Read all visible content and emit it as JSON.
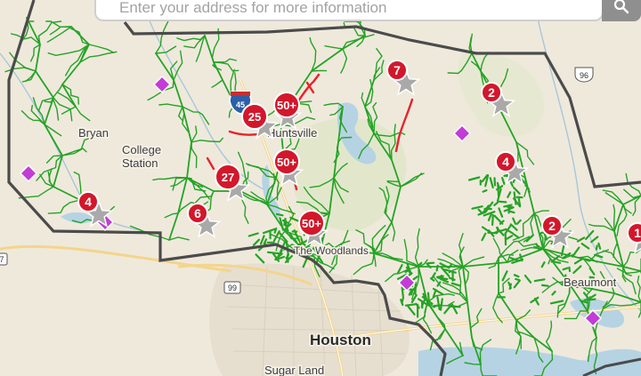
{
  "search": {
    "placeholder": "Enter your address for more information",
    "button_icon": "search-icon"
  },
  "colors": {
    "land": "#efe9dc",
    "service_lines": "#25a325",
    "outage_lines": "#e8232b",
    "boundary": "#4a4a4a",
    "marker_badge": "#d3172b",
    "marker_star": "#a8a8a8",
    "office_marker": "#c23cd6",
    "water": "#b6d3e3",
    "forest": "#dde5c6"
  },
  "cities": [
    {
      "label": "Bryan"
    },
    {
      "label": "College"
    },
    {
      "label": "Station"
    },
    {
      "label": "Huntsville"
    },
    {
      "label": "The Woodlands"
    },
    {
      "label": "Houston"
    },
    {
      "label": "Sugar Land"
    },
    {
      "label": "Beaumont"
    }
  ],
  "highway_shields": [
    {
      "label": "45",
      "type": "interstate"
    },
    {
      "label": "96",
      "type": "us"
    },
    {
      "label": "99",
      "type": "state"
    },
    {
      "label": "7",
      "type": "state"
    }
  ],
  "outage_markers": [
    {
      "count": "7"
    },
    {
      "count": "50+"
    },
    {
      "count": "25"
    },
    {
      "count": "2"
    },
    {
      "count": "50+"
    },
    {
      "count": "4"
    },
    {
      "count": "27"
    },
    {
      "count": "4"
    },
    {
      "count": "6"
    },
    {
      "count": "50+"
    },
    {
      "count": "2"
    },
    {
      "count": "1"
    }
  ],
  "office_markers": 6
}
